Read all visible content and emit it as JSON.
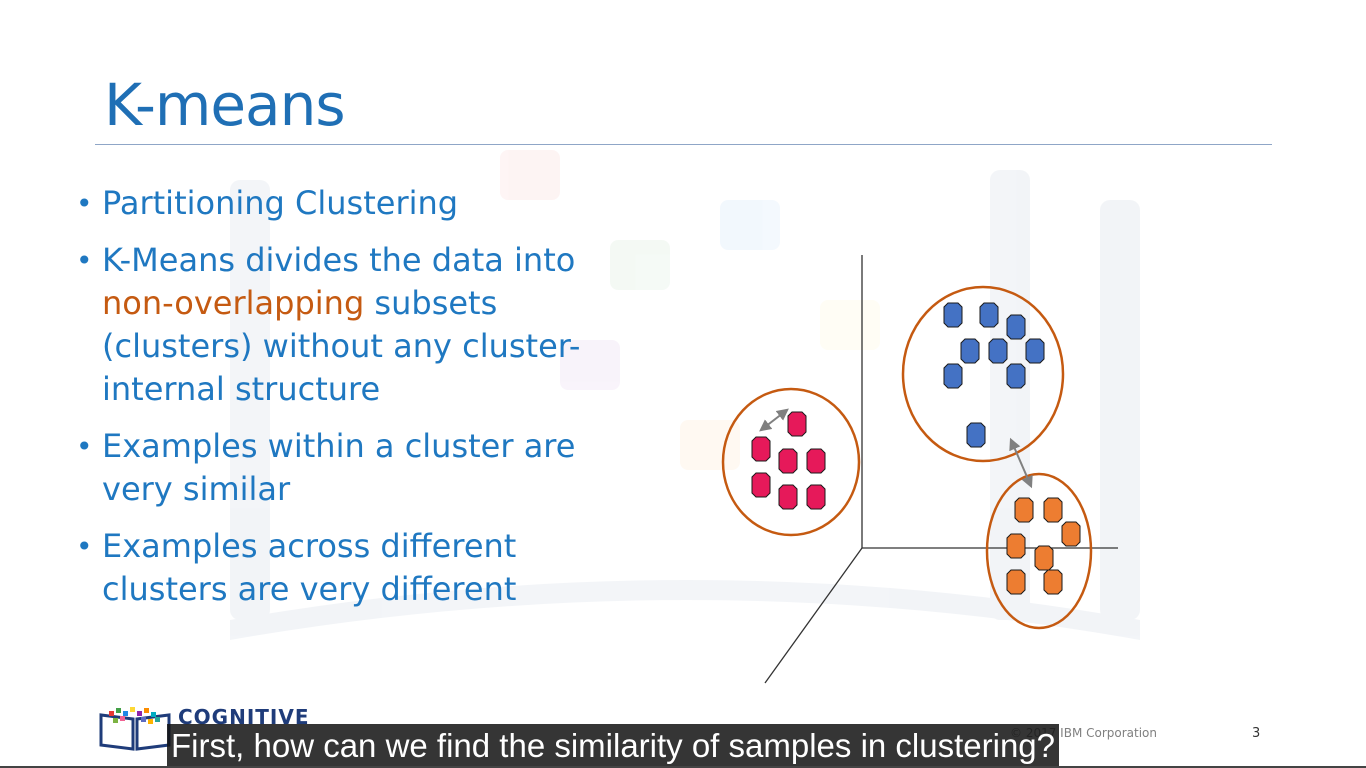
{
  "slide": {
    "title": "K-means",
    "bullets": [
      {
        "text": "Partitioning Clustering"
      },
      {
        "before": "K-Means divides the data into ",
        "highlight": "non-overlapping",
        "after": " subsets (clusters) without any cluster-internal structure"
      },
      {
        "text": "Examples within a cluster are very similar"
      },
      {
        "text": "Examples across different clusters are very different"
      }
    ],
    "logo_text": "COGNITIVE",
    "copyright": "© 2017 IBM Corporation",
    "page_number": "3"
  },
  "caption": "First, how can we find the similarity of samples in clustering?",
  "colors": {
    "title": "#1f6fb5",
    "bullet_text": "#1f78c1",
    "highlight": "#c55a11",
    "cluster_ring": "#c55a11",
    "pink_point": "#e6195a",
    "blue_point": "#4472c4",
    "orange_point": "#ed7d31"
  },
  "icons": {
    "logo": "cognitive-class-book-icon"
  }
}
